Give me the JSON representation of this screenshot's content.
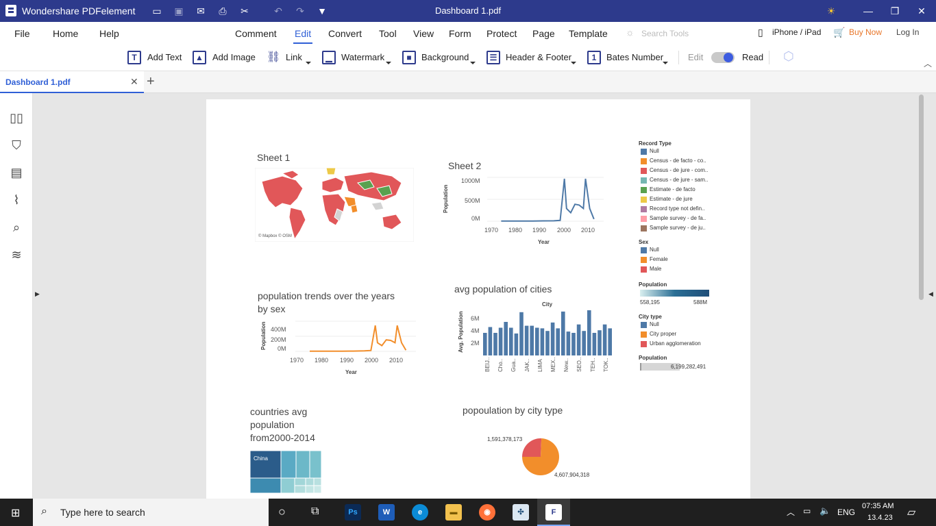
{
  "app": {
    "name": "Wondershare PDFelement",
    "window_title": "Dashboard 1.pdf"
  },
  "menus": {
    "file": "File",
    "home": "Home",
    "help": "Help",
    "comment": "Comment",
    "edit": "Edit",
    "convert": "Convert",
    "tool": "Tool",
    "view": "View",
    "form": "Form",
    "protect": "Protect",
    "page": "Page",
    "template": "Template",
    "search_tools": "Search Tools",
    "iphone_ipad": "iPhone / iPad",
    "buy_now": "Buy Now",
    "login": "Log In"
  },
  "toolbar": {
    "add_text": "Add Text",
    "add_image": "Add Image",
    "link": "Link",
    "watermark": "Watermark",
    "background": "Background",
    "header_footer": "Header & Footer",
    "bates_number": "Bates Number",
    "edit": "Edit",
    "read": "Read"
  },
  "tab": {
    "label": "Dashboard 1.pdf",
    "new_tab": "+"
  },
  "dashboard": {
    "sheet1": {
      "title": "Sheet 1",
      "attribution": "© Mapbox © OSM"
    },
    "sheet2": {
      "title": "Sheet 2",
      "ylabel": "Population",
      "xlabel": "Year",
      "yticks": [
        "1000M",
        "500M",
        "0M"
      ],
      "xticks": [
        "1970",
        "1980",
        "1990",
        "2000",
        "2010"
      ]
    },
    "trends": {
      "title_line1": "population trends over the years",
      "title_line2": "by sex",
      "ylabel": "Population",
      "xlabel": "Year",
      "yticks": [
        "400M",
        "200M",
        "0M"
      ],
      "xticks": [
        "1970",
        "1980",
        "1990",
        "2000",
        "2010"
      ]
    },
    "cities": {
      "title": "avg population of cities",
      "top_label": "City",
      "ylabel": "Avg. Population",
      "yticks": [
        "6M",
        "4M",
        "2M"
      ],
      "xlabels": [
        "BEIJ..",
        "Cho..",
        "Gua..",
        "JAK..",
        "LIMA",
        "MEX..",
        "New..",
        "SEO..",
        "TEH..",
        "TOK.."
      ]
    },
    "treemap": {
      "title_line1": "countries avg",
      "title_line2": "population",
      "title_line3": "from2000-2014",
      "cell_label": "China"
    },
    "pie": {
      "title": "popoulation by city type",
      "label_small": "1,591,378,173",
      "label_large": "4,607,904,318"
    },
    "legend": {
      "record_type": {
        "title": "Record Type",
        "items": [
          {
            "label": "Null",
            "color": "#4e79a7"
          },
          {
            "label": "Census - de facto - co..",
            "color": "#f28e2b"
          },
          {
            "label": "Census - de jure - com..",
            "color": "#e15759"
          },
          {
            "label": "Census - de jure - sam..",
            "color": "#76b7b2"
          },
          {
            "label": "Estimate - de facto",
            "color": "#59a14f"
          },
          {
            "label": "Estimate - de jure",
            "color": "#edc948"
          },
          {
            "label": "Record type not defin..",
            "color": "#b07aa1"
          },
          {
            "label": "Sample survey - de fa..",
            "color": "#ff9da7"
          },
          {
            "label": "Sample survey - de ju..",
            "color": "#9c755f"
          }
        ]
      },
      "sex": {
        "title": "Sex",
        "items": [
          {
            "label": "Null",
            "color": "#4e79a7"
          },
          {
            "label": "Female",
            "color": "#f28e2b"
          },
          {
            "label": "Male",
            "color": "#e15759"
          }
        ]
      },
      "population": {
        "title": "Population",
        "min": "558,195",
        "max": "588M"
      },
      "city_type": {
        "title": "City type",
        "items": [
          {
            "label": "Null",
            "color": "#4e79a7"
          },
          {
            "label": "City proper",
            "color": "#f28e2b"
          },
          {
            "label": "Urban agglomeration",
            "color": "#e15759"
          }
        ]
      },
      "population2": {
        "title": "Population",
        "value": "6,199,282,491"
      }
    }
  },
  "chart_data": [
    {
      "type": "line",
      "title": "Sheet 2",
      "xlabel": "Year",
      "ylabel": "Population",
      "ylim": [
        0,
        1000000000
      ],
      "x": [
        1970,
        1975,
        1980,
        1985,
        1990,
        1995,
        1998,
        2000,
        2001,
        2003,
        2005,
        2007,
        2009,
        2010,
        2012,
        2014
      ],
      "series": [
        {
          "values": [
            5000000,
            5000000,
            5000000,
            5000000,
            8000000,
            10000000,
            20000000,
            1000000000,
            300000000,
            200000000,
            400000000,
            380000000,
            300000000,
            1000000000,
            300000000,
            50000000
          ]
        }
      ]
    },
    {
      "type": "line",
      "title": "population trends over the years by sex",
      "xlabel": "Year",
      "ylabel": "Population",
      "ylim": [
        0,
        500000000
      ],
      "x": [
        1970,
        1975,
        1980,
        1985,
        1990,
        1995,
        1998,
        2000,
        2001,
        2003,
        2005,
        2007,
        2009,
        2010,
        2012,
        2014
      ],
      "series": [
        {
          "name": "Female",
          "values": [
            3000000,
            3000000,
            3000000,
            3000000,
            5000000,
            8000000,
            15000000,
            450000000,
            150000000,
            100000000,
            200000000,
            190000000,
            150000000,
            450000000,
            150000000,
            20000000
          ]
        }
      ]
    },
    {
      "type": "bar",
      "title": "avg population of cities",
      "ylabel": "Avg. Population",
      "ylim": [
        0,
        7000000
      ],
      "values": [
        3500000,
        4400000,
        3500000,
        4300000,
        5200000,
        4300000,
        3400000,
        6700000,
        4600000,
        4600000,
        4300000,
        4200000,
        3800000,
        5100000,
        4200000,
        6800000,
        3700000,
        3500000,
        4800000,
        3800000,
        7000000,
        3500000,
        3900000,
        4800000,
        4200000
      ]
    },
    {
      "type": "pie",
      "title": "popoulation by city type",
      "categories": [
        "Urban agglomeration",
        "City proper"
      ],
      "values": [
        1591378173,
        4607904318
      ]
    }
  ]
}
